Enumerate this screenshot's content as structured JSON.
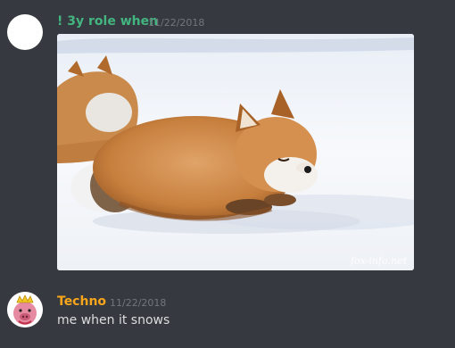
{
  "messages": [
    {
      "author": "! 3y role when",
      "timestamp": "11/22/2018",
      "author_color": "#43b581",
      "attachment": {
        "watermark": "fox-info.net",
        "subject": "fox lying in snow"
      }
    },
    {
      "author": "Techno",
      "timestamp": "11/22/2018",
      "author_color": "#faa61a",
      "content": "me when it snows",
      "avatar_icon": "pig-with-crown-icon"
    }
  ],
  "theme": {
    "background": "#36393f",
    "text": "#dcddde",
    "muted": "#72767d"
  }
}
